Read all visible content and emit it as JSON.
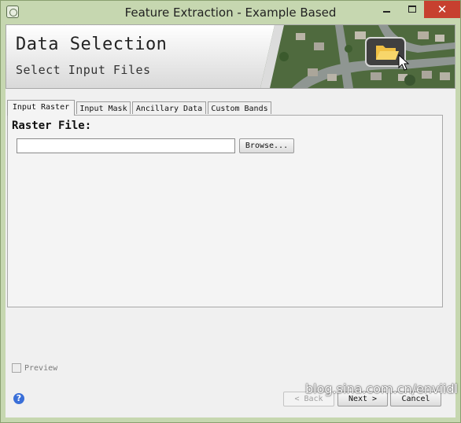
{
  "window": {
    "title": "Feature Extraction - Example Based",
    "close_glyph": "✕"
  },
  "banner": {
    "title": "Data Selection",
    "subtitle": "Select Input Files",
    "image_icon": "open-folder-icon"
  },
  "tabs": [
    {
      "label": "Input Raster",
      "active": true
    },
    {
      "label": "Input Mask",
      "active": false
    },
    {
      "label": "Ancillary Data",
      "active": false
    },
    {
      "label": "Custom Bands",
      "active": false
    }
  ],
  "panel": {
    "raster_label": "Raster File:",
    "raster_value": "",
    "browse_label": "Browse..."
  },
  "preview": {
    "label": "Preview",
    "checked": false,
    "enabled": false
  },
  "footer": {
    "help_glyph": "?",
    "back_label": "< Back",
    "next_label": "Next >",
    "cancel_label": "Cancel"
  },
  "watermark": "blog.sina.com.cn/enviidl",
  "colors": {
    "window_frame": "#c6d7b0",
    "close_button": "#c7402f",
    "help_icon": "#3a6fd8"
  }
}
